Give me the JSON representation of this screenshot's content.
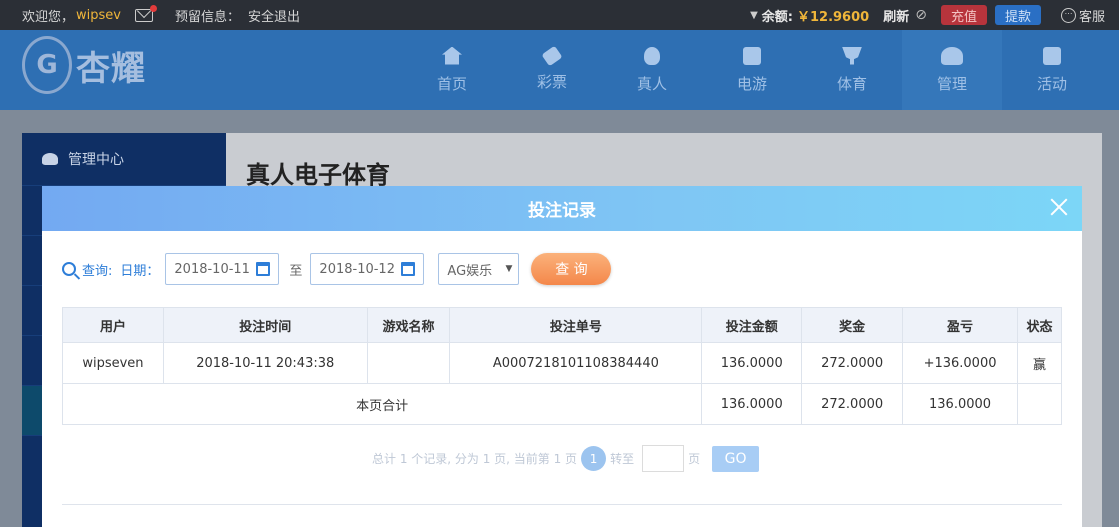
{
  "topbar": {
    "welcome": "欢迎您，",
    "username": "wipsev",
    "reserved_info": "预留信息：",
    "logout": "安全退出",
    "balance_label": "余额:",
    "balance_value": "￥12.9600",
    "refresh": "刷新",
    "recharge": "充值",
    "withdraw": "提款",
    "service": "客服"
  },
  "header": {
    "logo_text": "杏耀",
    "nav": [
      {
        "label": "首页",
        "icon": "home-icon"
      },
      {
        "label": "彩票",
        "icon": "ticket-icon"
      },
      {
        "label": "真人",
        "icon": "live-dealer-icon"
      },
      {
        "label": "电游",
        "icon": "slot-machine-icon"
      },
      {
        "label": "体育",
        "icon": "trophy-icon"
      },
      {
        "label": "管理",
        "icon": "users-icon"
      },
      {
        "label": "活动",
        "icon": "gift-icon"
      }
    ],
    "active_nav": "管理"
  },
  "sidebar": {
    "title": "管理中心"
  },
  "page": {
    "title": "真人电子体育"
  },
  "modal": {
    "title": "投注记录",
    "query": {
      "label": "查询:",
      "date_label": "日期：",
      "date_from": "2018-10-11",
      "to": "至",
      "date_to": "2018-10-12",
      "platform": "AG娱乐",
      "button": "查 询"
    },
    "table": {
      "headers": [
        "用户",
        "投注时间",
        "游戏名称",
        "投注单号",
        "投注金额",
        "奖金",
        "盈亏",
        "状态"
      ],
      "rows": [
        [
          "wipseven",
          "2018-10-11 20:43:38",
          "",
          "A0007218101108384440",
          "136.0000",
          "272.0000",
          "+136.0000",
          "赢"
        ]
      ],
      "subtotal": {
        "label": "本页合计",
        "bet": "136.0000",
        "bonus": "272.0000",
        "profit": "136.0000"
      }
    },
    "pager": {
      "summary": "总计 1 个记录, 分为 1 页, 当前第 1 页",
      "current": "1",
      "goto": "转至",
      "page_unit": "页",
      "go": "GO"
    }
  },
  "colors": {
    "accent": "#2e7ed8",
    "profit_positive": "#1e8a2e",
    "profit_negative": "#d7262b",
    "modal_header_start": "#73a9f2",
    "modal_header_end": "#7cd6f7"
  }
}
